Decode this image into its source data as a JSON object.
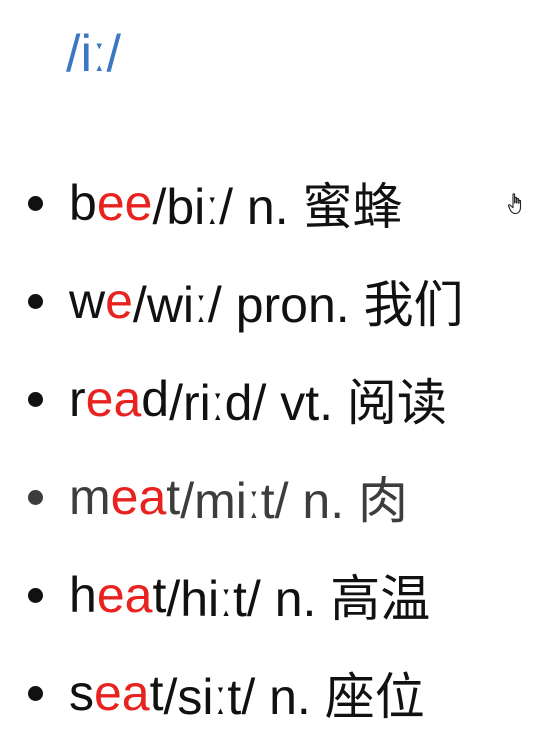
{
  "title": "/iː/",
  "highlight_color": "#e8231f",
  "title_color": "#3a78c3",
  "cursor": "hand-pointer-icon",
  "words": [
    {
      "segments": [
        {
          "text": "b",
          "hl": false
        },
        {
          "text": "ee",
          "hl": true
        }
      ],
      "rest": " /biː/ n. 蜜蜂"
    },
    {
      "segments": [
        {
          "text": "w",
          "hl": false
        },
        {
          "text": "e",
          "hl": true
        }
      ],
      "rest": " /wiː/ pron. 我们"
    },
    {
      "segments": [
        {
          "text": "r",
          "hl": false
        },
        {
          "text": "ea",
          "hl": true
        },
        {
          "text": "d",
          "hl": false
        }
      ],
      "rest": " /riːd/ vt. 阅读"
    },
    {
      "segments": [
        {
          "text": "m",
          "hl": false
        },
        {
          "text": "ea",
          "hl": true
        },
        {
          "text": "t",
          "hl": false
        }
      ],
      "rest": " /miːt/ n. 肉"
    },
    {
      "segments": [
        {
          "text": "h",
          "hl": false
        },
        {
          "text": "ea",
          "hl": true
        },
        {
          "text": "t",
          "hl": false
        }
      ],
      "rest": " /hiːt/ n. 高温"
    },
    {
      "segments": [
        {
          "text": "s",
          "hl": false
        },
        {
          "text": "ea",
          "hl": true
        },
        {
          "text": "t",
          "hl": false
        }
      ],
      "rest": " /siːt/ n. 座位"
    }
  ]
}
